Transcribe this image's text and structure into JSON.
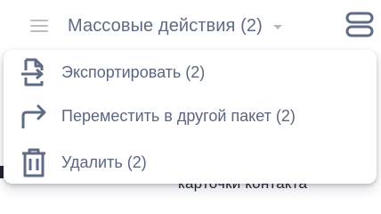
{
  "toolbar": {
    "bulk_actions_label": "Массовые действия (2)",
    "icons": {
      "menu": "lines-icon",
      "caret": "chevron-down-icon",
      "view_toggle": "view-toggle-icon"
    }
  },
  "menu": {
    "items": [
      {
        "label": "Экспортировать (2)",
        "icon": "export-file-icon"
      },
      {
        "label": "Переместить в другой пакет (2)",
        "icon": "move-arrow-icon"
      },
      {
        "label": "Удалить (2)",
        "icon": "trash-icon"
      }
    ]
  },
  "background": {
    "partial_text": "карточки контакта"
  },
  "colors": {
    "text": "#5b6681",
    "icon": "#5f6b84",
    "muted": "#b9bcc4"
  }
}
